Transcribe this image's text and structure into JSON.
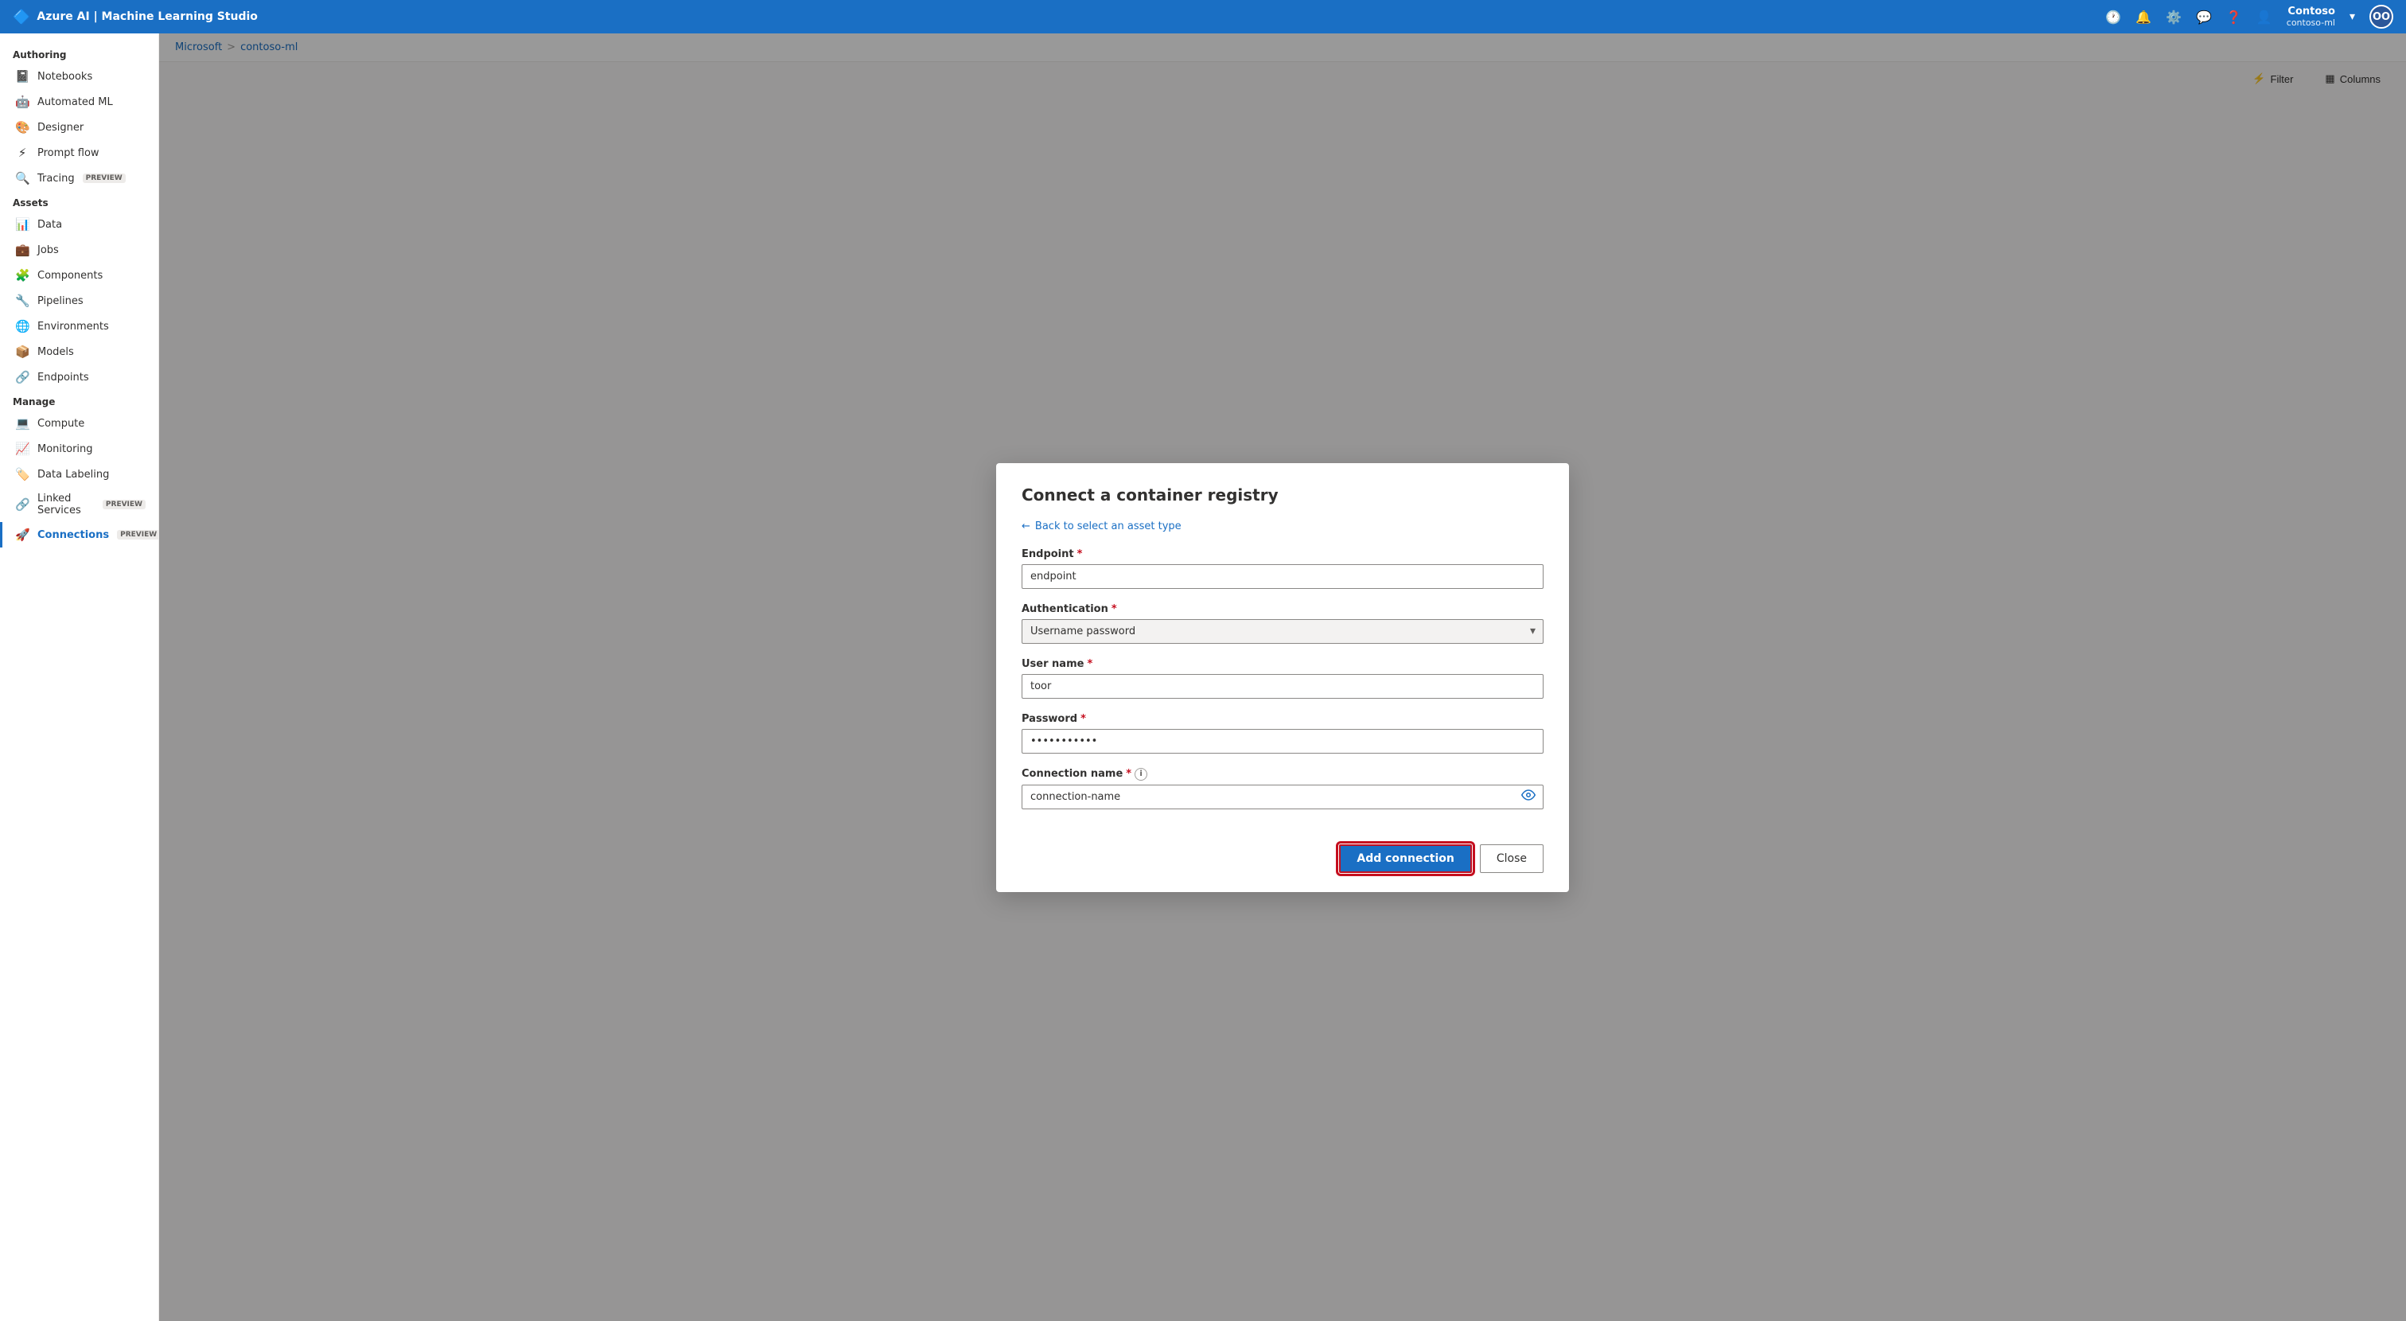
{
  "app": {
    "title": "Azure AI | Machine Learning Studio"
  },
  "topbar": {
    "title": "Azure AI | Machine Learning Studio",
    "user": {
      "name": "Contoso",
      "workspace": "contoso-ml",
      "avatar": "OO"
    },
    "icons": [
      "history",
      "bell",
      "settings",
      "chat",
      "help",
      "user"
    ]
  },
  "breadcrumb": {
    "items": [
      "Microsoft",
      "contoso-ml"
    ],
    "separator": ">"
  },
  "sidebar": {
    "authoring_label": "Authoring",
    "assets_label": "Assets",
    "manage_label": "Manage",
    "items": [
      {
        "id": "notebooks",
        "label": "Notebooks",
        "icon": "📓"
      },
      {
        "id": "automated-ml",
        "label": "Automated ML",
        "icon": "🤖"
      },
      {
        "id": "designer",
        "label": "Designer",
        "icon": "🎨"
      },
      {
        "id": "prompt-flow",
        "label": "Prompt flow",
        "icon": "⚡",
        "active": true
      },
      {
        "id": "tracing",
        "label": "Tracing",
        "icon": "🔍",
        "badge": "PREVIEW"
      },
      {
        "id": "data",
        "label": "Data",
        "icon": "📊"
      },
      {
        "id": "jobs",
        "label": "Jobs",
        "icon": "💼"
      },
      {
        "id": "components",
        "label": "Components",
        "icon": "🧩"
      },
      {
        "id": "pipelines",
        "label": "Pipelines",
        "icon": "🔧"
      },
      {
        "id": "environments",
        "label": "Environments",
        "icon": "🌐"
      },
      {
        "id": "models",
        "label": "Models",
        "icon": "📦"
      },
      {
        "id": "endpoints",
        "label": "Endpoints",
        "icon": "🔗"
      },
      {
        "id": "compute",
        "label": "Compute",
        "icon": "💻"
      },
      {
        "id": "monitoring",
        "label": "Monitoring",
        "icon": "📈"
      },
      {
        "id": "data-labeling",
        "label": "Data Labeling",
        "icon": "🏷️"
      },
      {
        "id": "linked-services",
        "label": "Linked Services",
        "icon": "🔗",
        "badge": "PREVIEW"
      },
      {
        "id": "connections",
        "label": "Connections",
        "icon": "🚀",
        "badge": "PREVIEW",
        "active": true
      }
    ]
  },
  "toolbar": {
    "filter_label": "Filter",
    "columns_label": "Columns"
  },
  "modal": {
    "title": "Connect a container registry",
    "back_label": "Back to select an asset type",
    "endpoint_label": "Endpoint",
    "endpoint_value": "endpoint",
    "authentication_label": "Authentication",
    "authentication_value": "Username password",
    "username_label": "User name",
    "username_value": "toor",
    "password_label": "Password",
    "password_value": "••••••••",
    "connection_name_label": "Connection name",
    "connection_name_value": "connection-name",
    "add_connection_label": "Add connection",
    "close_label": "Close"
  }
}
